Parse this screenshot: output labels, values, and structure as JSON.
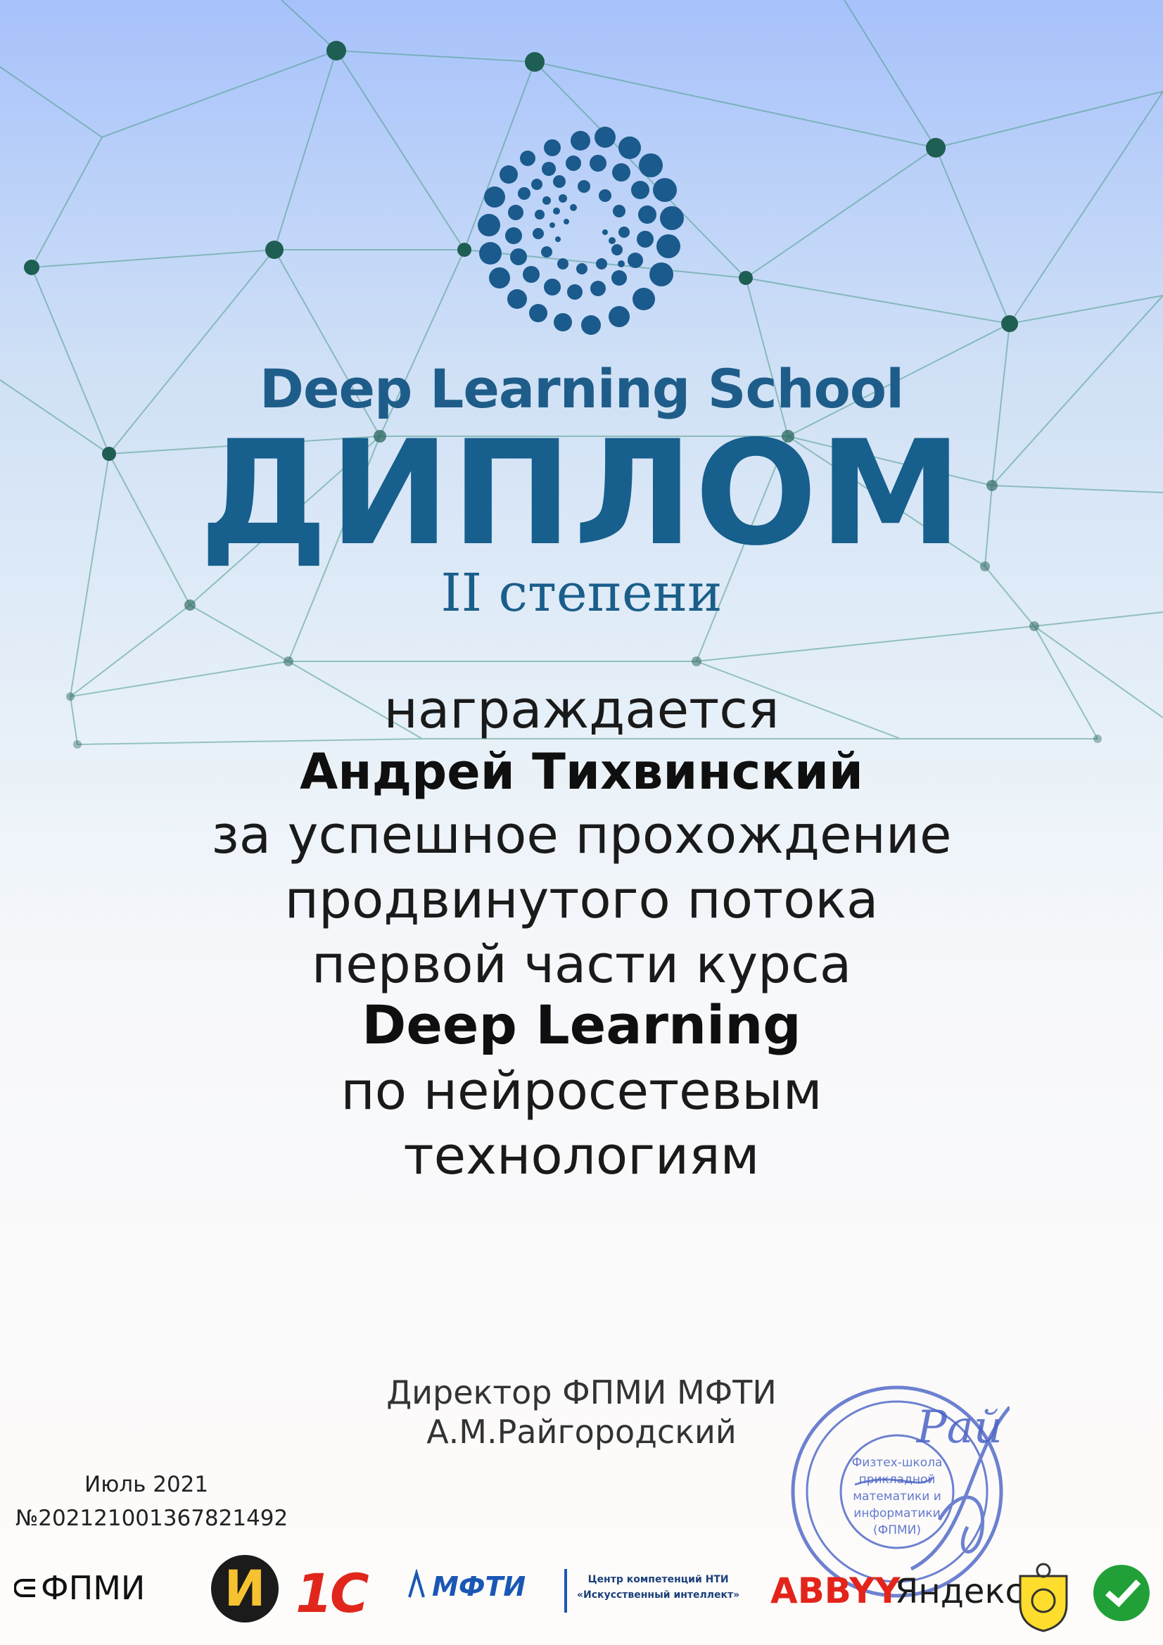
{
  "header": {
    "school_name": "Deep Learning School",
    "title": "ДИПЛОМ",
    "degree": "II степени"
  },
  "award": {
    "lead": "награждается",
    "recipient": "Андрей Тихвинский",
    "line1": "за успешное прохождение",
    "line2": "продвинутого потока",
    "line3": "первой части курса",
    "course": "Deep Learning",
    "line4": "по нейросетевым",
    "line5": "технологиям"
  },
  "signature": {
    "position": "Директор ФПМИ МФТИ",
    "name": "А.М.Райгородский",
    "handwritten": "Рай"
  },
  "stamp": {
    "center_lines": [
      "Физтех-школа",
      "прикладной",
      "математики и",
      "информатики",
      "(ФПМИ)"
    ]
  },
  "meta": {
    "date": "Июль 2021",
    "number": "№202121001367821492"
  },
  "partners": {
    "fpmi": "ФПМИ",
    "i_logo": "И",
    "onec": "1С",
    "mipt": "МФТИ",
    "nti_line1": "Центр компетенций НТИ",
    "nti_line2": "«Искусственный интеллект»",
    "abbyy": "ABBYY",
    "yandex": "Яндекс"
  },
  "colors": {
    "brand_blue": "#175f8c",
    "network_node": "#1f5e52",
    "network_line": "#4e9c8c",
    "stamp_blue": "#4a63c6"
  }
}
